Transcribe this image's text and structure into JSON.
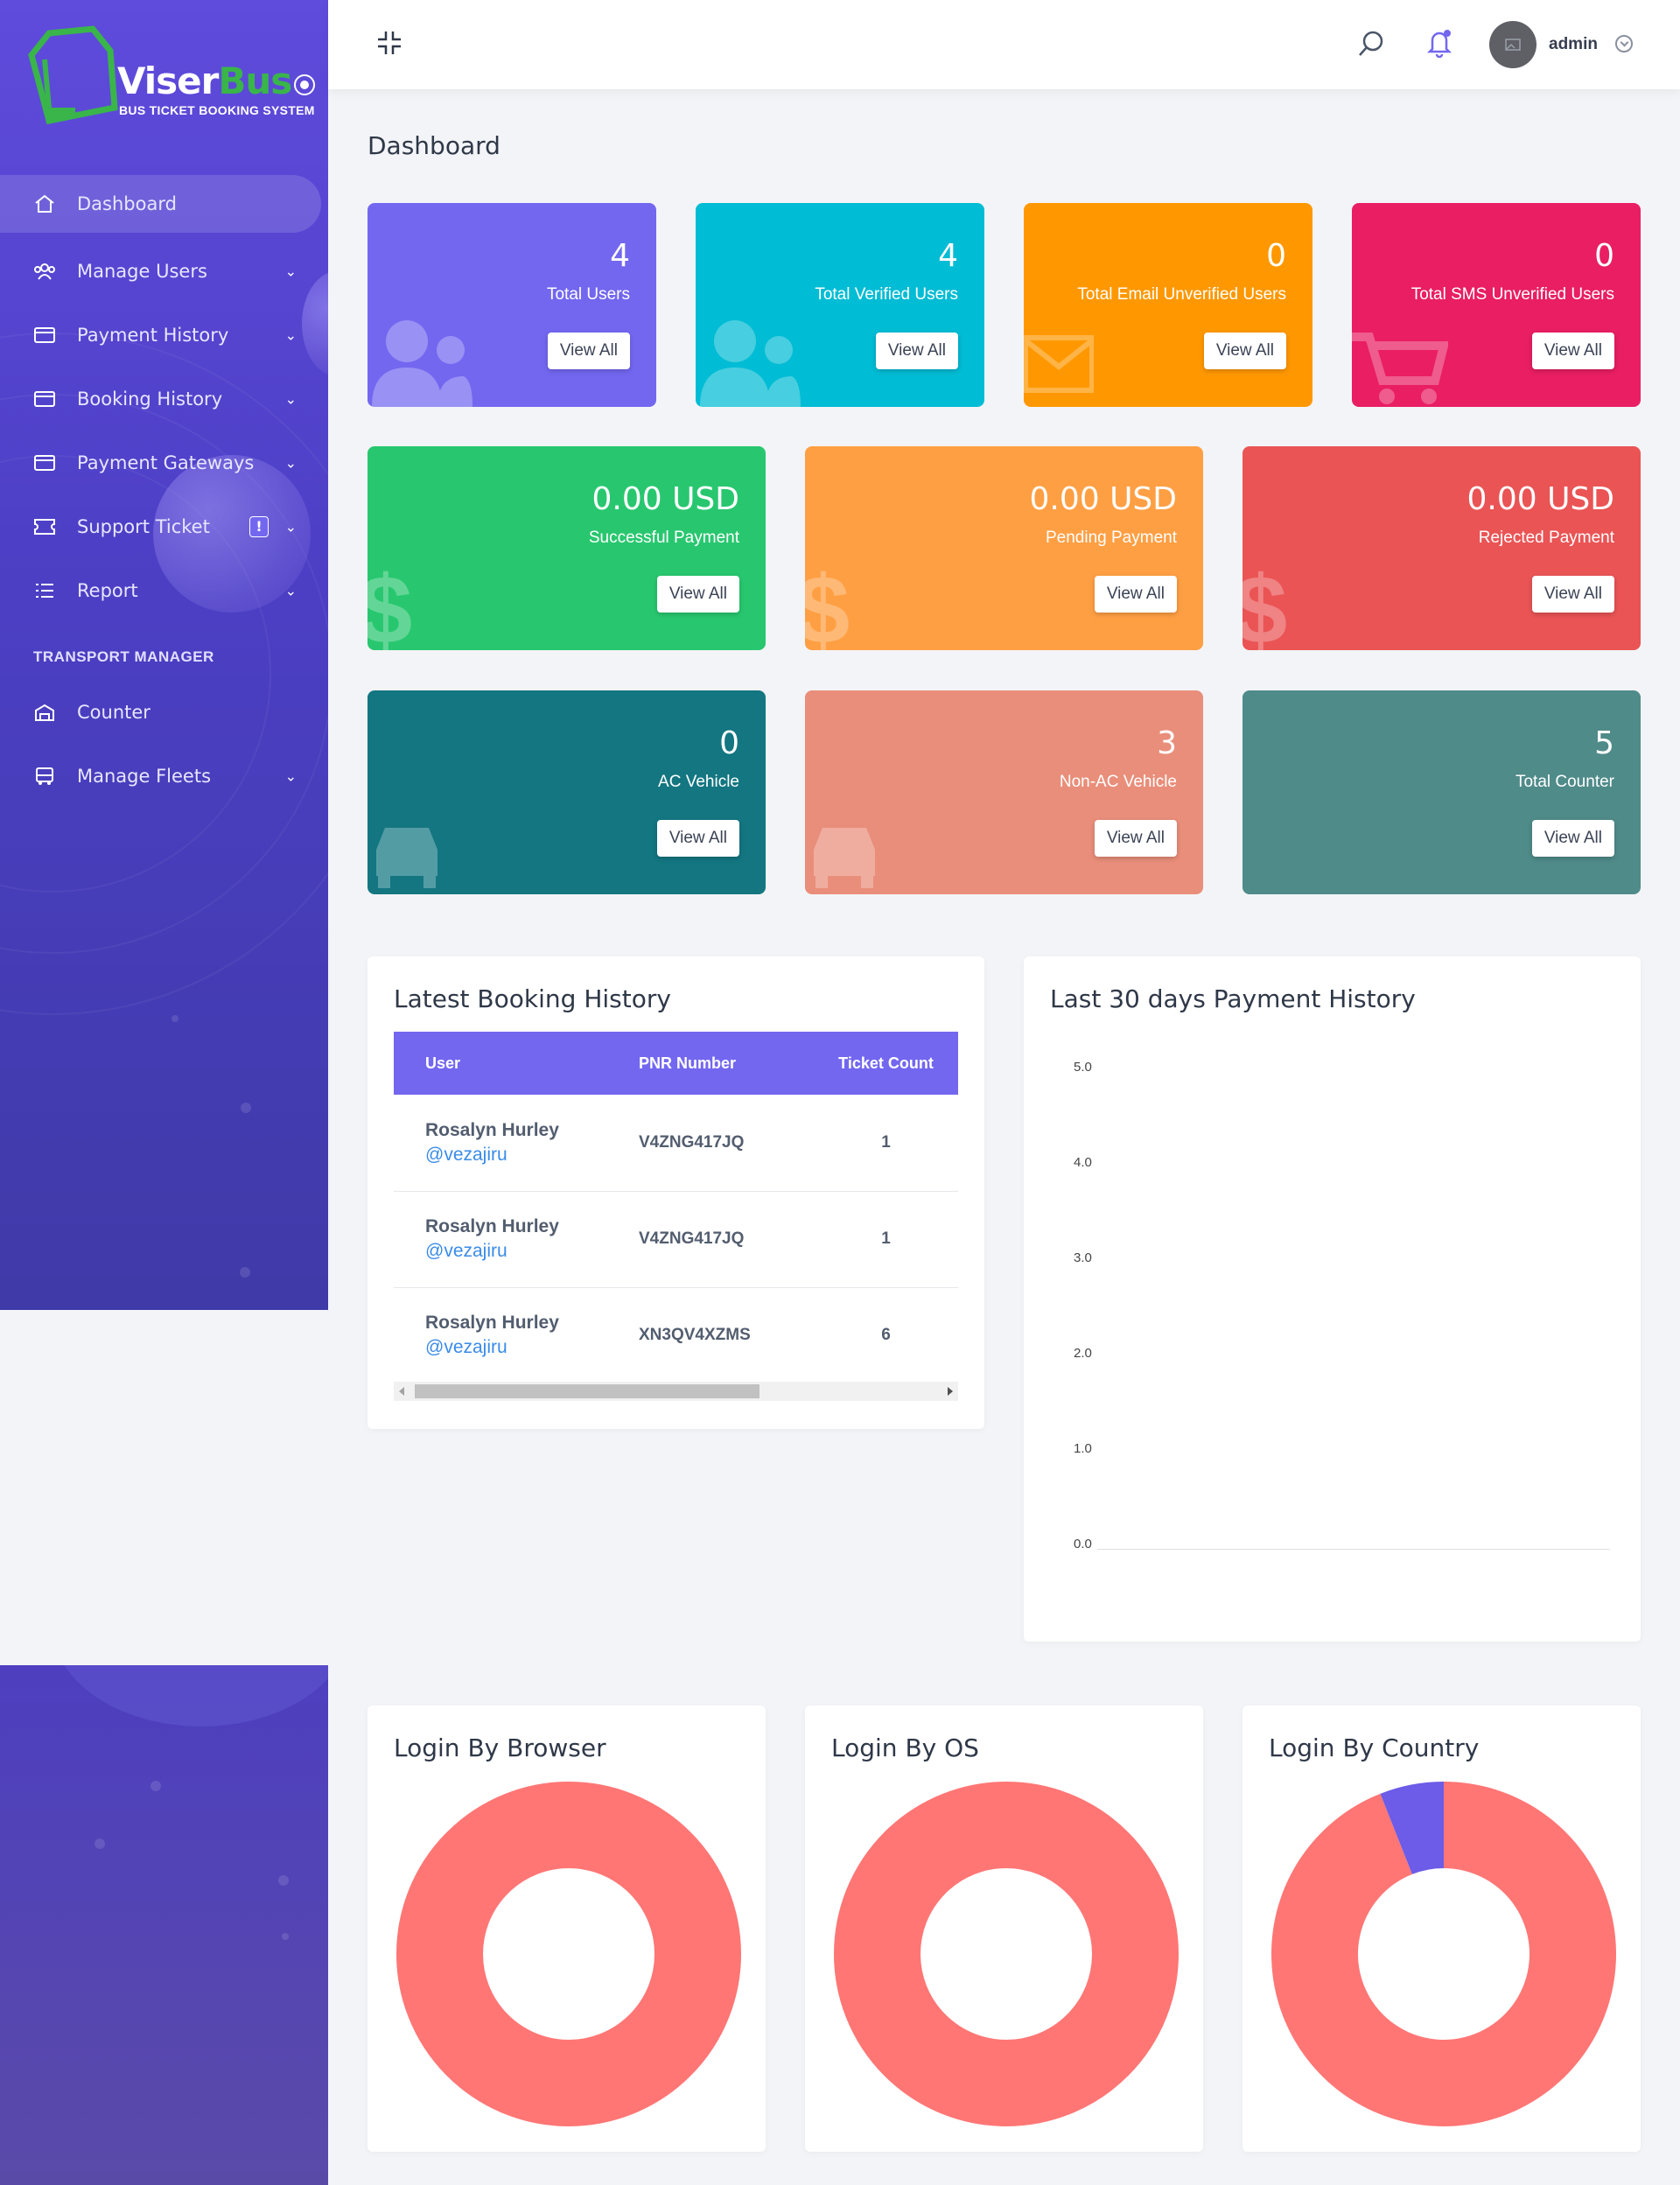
{
  "brand": {
    "name_white": "Viser",
    "name_green": "Bus",
    "tagline": "BUS TICKET BOOKING SYSTEM"
  },
  "sidebar": {
    "items": [
      {
        "label": "Dashboard",
        "icon": "home-icon",
        "active": true
      },
      {
        "label": "Manage Users",
        "icon": "users-icon"
      },
      {
        "label": "Payment History",
        "icon": "credit-card-icon"
      },
      {
        "label": "Booking History",
        "icon": "credit-card-icon"
      },
      {
        "label": "Payment Gateways",
        "icon": "credit-card-icon"
      },
      {
        "label": "Support Ticket",
        "icon": "ticket-icon",
        "badge": "!"
      },
      {
        "label": "Report",
        "icon": "list-icon"
      }
    ],
    "section_title": "TRANSPORT MANAGER",
    "manager_items": [
      {
        "label": "Counter",
        "icon": "building-icon"
      },
      {
        "label": "Manage Fleets",
        "icon": "bus-icon"
      }
    ]
  },
  "header": {
    "username": "admin"
  },
  "page_title": "Dashboard",
  "widgets_row1": [
    {
      "value": "4",
      "label": "Total Users",
      "button": "View All",
      "color": "#7367f0"
    },
    {
      "value": "4",
      "label": "Total Verified Users",
      "button": "View All",
      "color": "#00bcd4"
    },
    {
      "value": "0",
      "label": "Total Email Unverified Users",
      "button": "View All",
      "color": "#ff9800"
    },
    {
      "value": "0",
      "label": "Total SMS Unverified Users",
      "button": "View All",
      "color": "#e91e63"
    }
  ],
  "widgets_row2": [
    {
      "value": "0.00 USD",
      "label": "Successful Payment",
      "button": "View All",
      "color": "#28c76f"
    },
    {
      "value": "0.00 USD",
      "label": "Pending Payment",
      "button": "View All",
      "color": "#ff9f43"
    },
    {
      "value": "0.00 USD",
      "label": "Rejected Payment",
      "button": "View All",
      "color": "#ea5455"
    }
  ],
  "widgets_row3": [
    {
      "value": "0",
      "label": "AC Vehicle",
      "button": "View All",
      "color": "#137681"
    },
    {
      "value": "3",
      "label": "Non-AC Vehicle",
      "button": "View All",
      "color": "#e98e7a"
    },
    {
      "value": "5",
      "label": "Total Counter",
      "button": "View All",
      "color": "#4f8b89"
    }
  ],
  "booking": {
    "title": "Latest Booking History",
    "columns": [
      "User",
      "PNR Number",
      "Ticket Count"
    ],
    "rows": [
      {
        "name": "Rosalyn Hurley",
        "handle": "@vezajiru",
        "pnr": "V4ZNG417JQ",
        "count": "1"
      },
      {
        "name": "Rosalyn Hurley",
        "handle": "@vezajiru",
        "pnr": "V4ZNG417JQ",
        "count": "1"
      },
      {
        "name": "Rosalyn Hurley",
        "handle": "@vezajiru",
        "pnr": "XN3QV4XZMS",
        "count": "6"
      }
    ]
  },
  "payment_chart": {
    "title": "Last 30 days Payment History",
    "yticks": [
      "5.0",
      "4.0",
      "3.0",
      "2.0",
      "1.0",
      "0.0"
    ]
  },
  "chart_data": [
    {
      "type": "line",
      "title": "Last 30 days Payment History",
      "ylim": [
        0,
        5
      ],
      "series": []
    },
    {
      "type": "pie",
      "title": "Login By Browser",
      "values": [
        1
      ],
      "colors": [
        "#ff7675"
      ]
    },
    {
      "type": "pie",
      "title": "Login By OS",
      "values": [
        1
      ],
      "colors": [
        "#ff7675"
      ]
    },
    {
      "type": "pie",
      "title": "Login By Country",
      "values": [
        0.94,
        0.06
      ],
      "colors": [
        "#ff7675",
        "#6c5ce7"
      ]
    }
  ],
  "login_charts": [
    {
      "title": "Login By Browser"
    },
    {
      "title": "Login By OS"
    },
    {
      "title": "Login By Country"
    }
  ]
}
